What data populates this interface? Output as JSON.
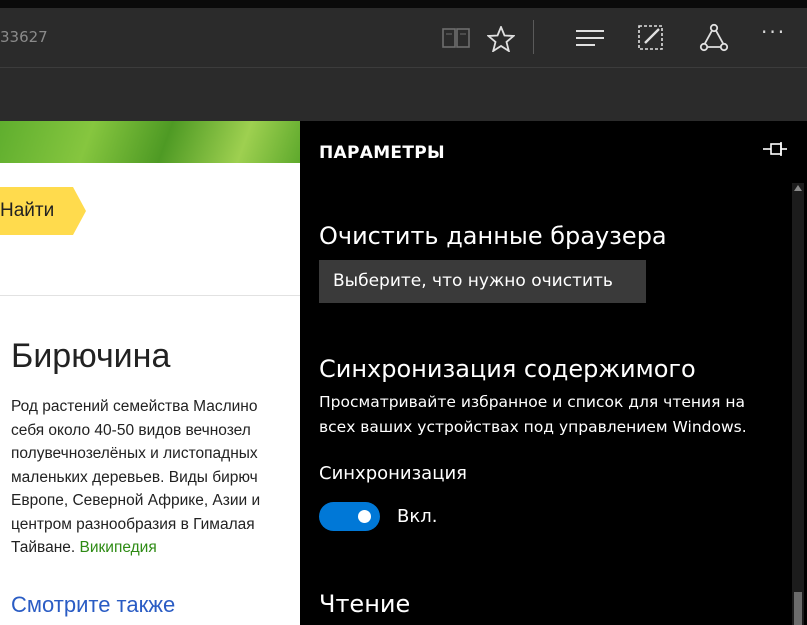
{
  "browser": {
    "url_fragment": "33627",
    "toolbar": [
      {
        "name": "reading-view-icon",
        "glyph": "📖"
      },
      {
        "name": "favorite-star-icon",
        "glyph": "☆"
      },
      {
        "name": "hub-icon",
        "glyph": "☰"
      },
      {
        "name": "web-note-icon",
        "glyph": "✎"
      },
      {
        "name": "share-icon",
        "glyph": "⟁"
      },
      {
        "name": "more-icon",
        "glyph": "···"
      }
    ]
  },
  "page": {
    "find_button": "Найти",
    "heading": "Бирючина",
    "description_lines": [
      "Род растений семейства Маслино",
      "себя около 40-50 видов вечнозел",
      "полувечнозелёных и листопадных",
      "маленьких деревьев. Виды бирюч",
      "Европе, Северной Африке, Азии и",
      "центром разнообразия в Гималая",
      "Тайване. "
    ],
    "wiki_link": "Википедия",
    "see_also": "Смотрите также"
  },
  "settings": {
    "title": "ПАРАМЕТРЫ",
    "clear": {
      "heading": "Очистить данные браузера",
      "button": "Выберите, что нужно очистить"
    },
    "sync": {
      "heading": "Синхронизация содержимого",
      "desc_line1": "Просматривайте избранное и список для чтения на",
      "desc_line2": "всех ваших устройствах под управлением Windows.",
      "label": "Синхронизация",
      "toggle_state": "Вкл."
    },
    "reading": {
      "heading": "Чтение"
    }
  },
  "colors": {
    "toggle_on": "#0078d7",
    "panel_bg": "#000000",
    "find_button": "#ffdb4d",
    "wiki_link": "#2e8b14",
    "see_also": "#2a5cc4"
  }
}
